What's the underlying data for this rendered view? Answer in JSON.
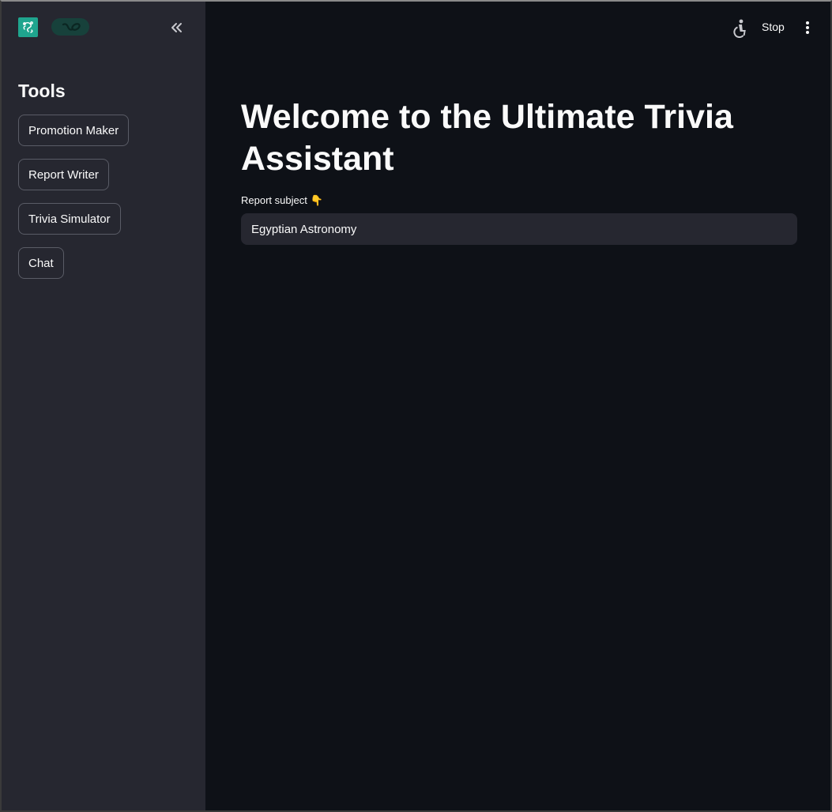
{
  "sidebar": {
    "title": "Tools",
    "items": [
      {
        "label": "Promotion Maker"
      },
      {
        "label": "Report Writer"
      },
      {
        "label": "Trivia Simulator"
      },
      {
        "label": "Chat"
      }
    ]
  },
  "header": {
    "stop_label": "Stop",
    "icons": [
      "app-logo-icon",
      "link-icon",
      "collapse-sidebar-icon",
      "accessibility-icon",
      "more-options-icon"
    ]
  },
  "main": {
    "title": "Welcome to the Ultimate Trivia Assistant",
    "field": {
      "label": "Report subject",
      "label_emoji": "👇",
      "value": "Egyptian Astronomy"
    }
  },
  "colors": {
    "main_bg": "#0e1117",
    "sidebar_bg": "#262730",
    "accent": "#1fa58e"
  }
}
